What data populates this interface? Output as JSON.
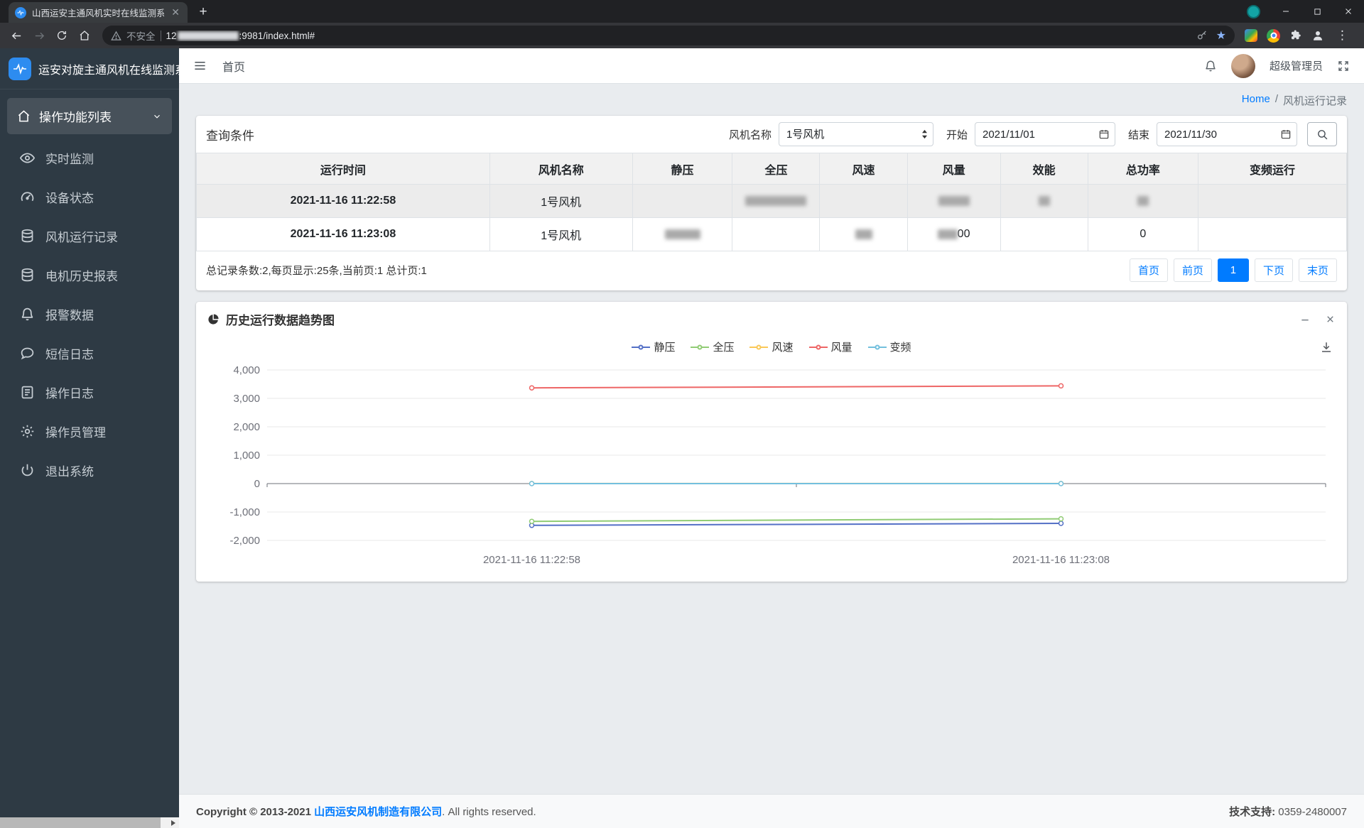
{
  "browser": {
    "tab_title": "山西运安主通风机实时在线监测系...",
    "new_tab_label": "+",
    "security_label": "不安全",
    "url_prefix": "12",
    "url_suffix": ":9981/index.html#"
  },
  "sidebar": {
    "brand": "运安对旋主通风机在线监测系统",
    "section": {
      "label": "操作功能列表",
      "icon": "home-icon"
    },
    "items": [
      {
        "label": "实时监测",
        "icon": "eye-icon"
      },
      {
        "label": "设备状态",
        "icon": "gauge-icon"
      },
      {
        "label": "风机运行记录",
        "icon": "database-icon"
      },
      {
        "label": "电机历史报表",
        "icon": "database-icon"
      },
      {
        "label": "报警数据",
        "icon": "bell-icon"
      },
      {
        "label": "短信日志",
        "icon": "comment-icon"
      },
      {
        "label": "操作日志",
        "icon": "log-icon"
      },
      {
        "label": "操作员管理",
        "icon": "gear-icon"
      },
      {
        "label": "退出系统",
        "icon": "power-icon"
      }
    ]
  },
  "navbar": {
    "home_label": "首页",
    "username": "超级管理员"
  },
  "breadcrumb": {
    "home": "Home",
    "separator": "/",
    "current": "风机运行记录"
  },
  "query": {
    "title": "查询条件",
    "fan_label": "风机名称",
    "fan_value": "1号风机",
    "start_label": "开始",
    "start_value": "2021/11/01",
    "end_label": "结束",
    "end_value": "2021/11/30"
  },
  "table": {
    "headers": [
      "运行时间",
      "风机名称",
      "静压",
      "全压",
      "风速",
      "风量",
      "效能",
      "总功率",
      "变频运行"
    ],
    "rows": [
      {
        "cells": [
          {
            "text": "2021-11-16 11:22:58"
          },
          {
            "text": "1号风机"
          },
          {},
          {
            "blur": 86
          },
          {},
          {
            "blur": 44
          },
          {
            "blur": 16
          },
          {
            "blur": 16
          },
          {}
        ]
      },
      {
        "cells": [
          {
            "text": "2021-11-16 11:23:08"
          },
          {
            "text": "1号风机"
          },
          {
            "blur": 50
          },
          {},
          {
            "blur": 24
          },
          {
            "blur": 28,
            "text": "00"
          },
          {},
          {
            "text": "0"
          },
          {}
        ]
      }
    ]
  },
  "pagination": {
    "summary": "总记录条数:2,每页显示:25条,当前页:1 总计页:1",
    "items": [
      {
        "label": "首页"
      },
      {
        "label": "前页"
      },
      {
        "label": "1",
        "active": true
      },
      {
        "label": "下页"
      },
      {
        "label": "末页"
      }
    ]
  },
  "chart_panel": {
    "title": "历史运行数据趋势图",
    "minimize_icon": "minimize-icon",
    "close_icon": "close-icon",
    "download_icon": "download-icon"
  },
  "chart_data": {
    "type": "line",
    "x": [
      "2021-11-16 11:22:58",
      "2021-11-16 11:23:08"
    ],
    "series": [
      {
        "name": "静压",
        "color": "#5470c6",
        "values": [
          -1470,
          -1400
        ]
      },
      {
        "name": "全压",
        "color": "#91cc75",
        "values": [
          -1330,
          -1240
        ]
      },
      {
        "name": "风速",
        "color": "#fac858",
        "values": [
          3.4,
          3.6
        ]
      },
      {
        "name": "风量",
        "color": "#ee6666",
        "values": [
          3370,
          3440
        ]
      },
      {
        "name": "变频",
        "color": "#73c0de",
        "values": [
          0,
          0
        ]
      }
    ],
    "ylim": [
      -2000,
      4000
    ],
    "yticks": [
      4000,
      3000,
      2000,
      1000,
      0,
      -1000,
      -2000
    ],
    "grid": true,
    "legend_position": "top",
    "title": "",
    "xlabel": "",
    "ylabel": ""
  },
  "footer": {
    "copyright_prefix": "Copyright © 2013-2021 ",
    "company": "山西运安风机制造有限公司",
    "copyright_suffix": ". All rights reserved.",
    "support_label": "技术支持:",
    "support_value": "0359-2480007"
  },
  "colors": {
    "primary": "#007bff",
    "sidebar_bg": "#2e3a44",
    "brand_logo": "#2d8cf0"
  }
}
